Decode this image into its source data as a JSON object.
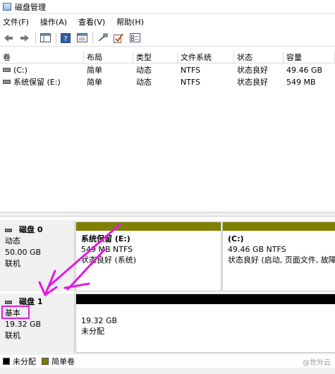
{
  "window": {
    "title": "磁盘管理"
  },
  "menu": [
    {
      "label": "文件(F)"
    },
    {
      "label": "操作(A)"
    },
    {
      "label": "查看(V)"
    },
    {
      "label": "帮助(H)"
    }
  ],
  "toolbar": {
    "icons": [
      "back-icon",
      "forward-icon",
      "console-tree-icon",
      "help-icon",
      "properties-icon",
      "connect-icon",
      "check-icon",
      "list-icon"
    ]
  },
  "volume_table": {
    "headers": [
      "卷",
      "布局",
      "类型",
      "文件系统",
      "状态",
      "容量"
    ],
    "rows": [
      [
        "(C:)",
        "简单",
        "动态",
        "NTFS",
        "状态良好",
        "49.46 GB"
      ],
      [
        "系统保留 (E:)",
        "简单",
        "动态",
        "NTFS",
        "状态良好",
        "549 MB"
      ]
    ]
  },
  "disks": [
    {
      "name": "磁盘 0",
      "type": "动态",
      "size": "50.00 GB",
      "status": "联机",
      "partitions": [
        {
          "title": "系统保留 (E:)",
          "line1": "549 MB NTFS",
          "line2": "状态良好 (系统)",
          "color": "#808000"
        },
        {
          "title": "(C:)",
          "line1": "49.46 GB NTFS",
          "line2": "状态良好 (启动, 页面文件, 故障",
          "color": "#808000"
        }
      ]
    },
    {
      "name": "磁盘 1",
      "type": "基本",
      "size": "19.32 GB",
      "status": "联机",
      "partitions": [
        {
          "line1": "19.32 GB",
          "line2": "未分配",
          "color": "#000000"
        }
      ]
    }
  ],
  "legend": [
    {
      "label": "未分配",
      "color": "#000000"
    },
    {
      "label": "简单卷",
      "color": "#808000"
    }
  ],
  "watermark": "@世外云",
  "annotation": {
    "color": "#e319e3"
  }
}
